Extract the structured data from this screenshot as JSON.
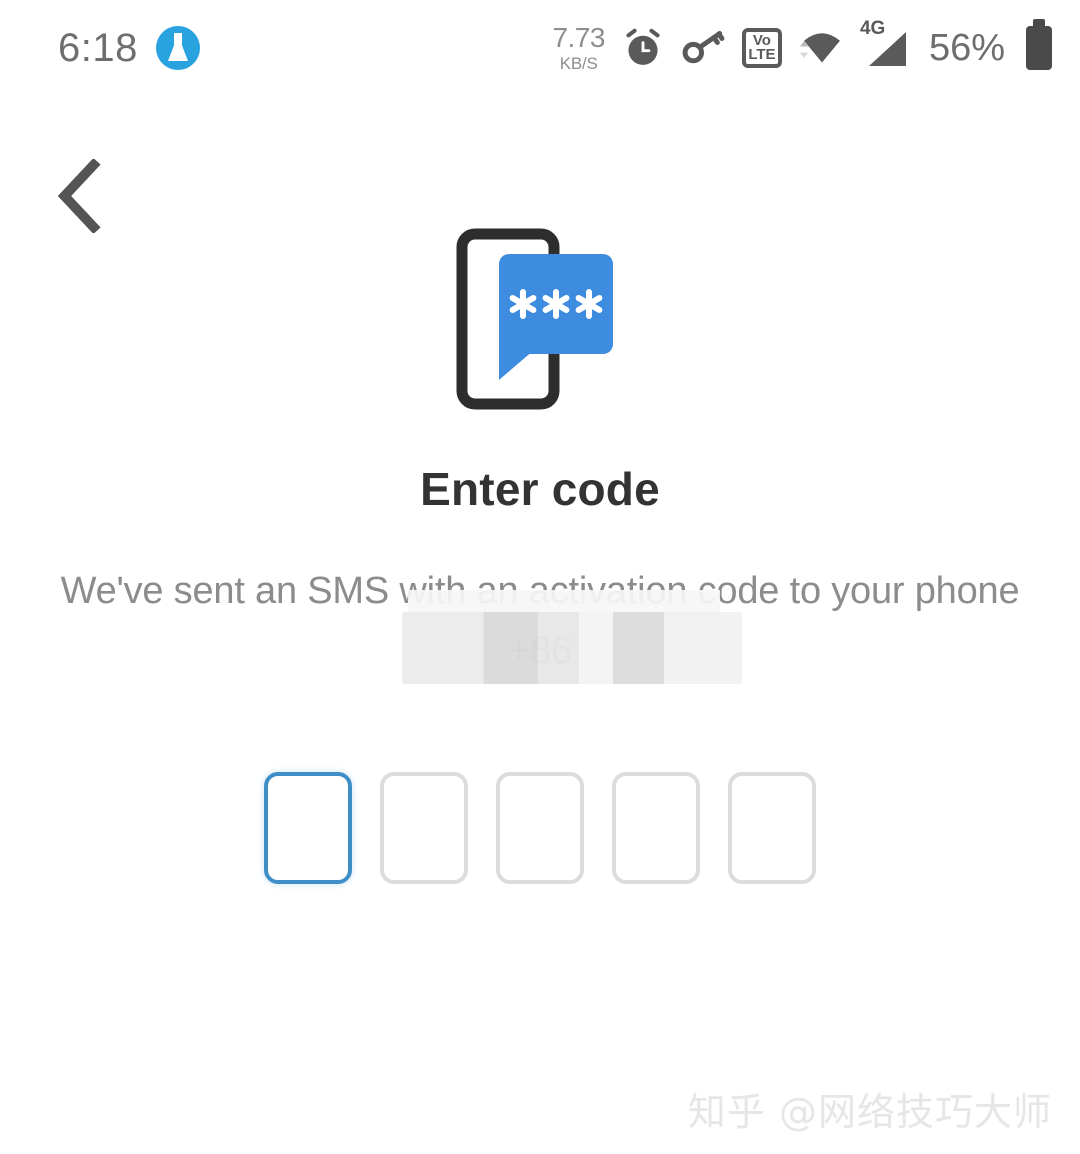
{
  "status_bar": {
    "clock": "6:18",
    "app_badge_icon": "flask-icon",
    "network_speed_value": "7.73",
    "network_speed_unit": "KB/S",
    "alarm_icon": "alarm-clock-icon",
    "vpn_icon": "key-icon",
    "volte_top": "Vo",
    "volte_bottom": "LTE",
    "wifi_icon": "wifi-icon",
    "cellular_label": "4G",
    "cellular_icon": "signal-bars-icon",
    "battery_percent": "56%",
    "battery_icon": "battery-icon"
  },
  "navigation": {
    "back_icon": "chevron-left-icon",
    "back_label": "Back"
  },
  "illustration": {
    "name": "phone-sms-code-illustration",
    "phone_outline_color": "#2d2d2d",
    "bubble_color": "#3d8ce0",
    "asterisks": "✱✱✱"
  },
  "main": {
    "title": "Enter code",
    "subtitle": "We've sent an SMS with an activation code to your phone",
    "phone_number_prefix": "+86",
    "phone_number_redacted": true
  },
  "code_entry": {
    "boxes": [
      {
        "value": "",
        "focused": true
      },
      {
        "value": "",
        "focused": false
      },
      {
        "value": "",
        "focused": false
      },
      {
        "value": "",
        "focused": false
      },
      {
        "value": "",
        "focused": false
      }
    ],
    "focus_color": "#3f8ec6",
    "idle_border_color": "#dcdcdc"
  },
  "watermark": {
    "text": "知乎 @网络技巧大师"
  }
}
